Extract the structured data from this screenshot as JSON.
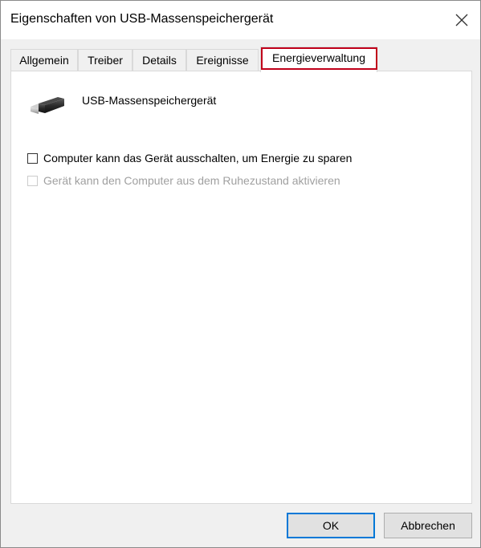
{
  "window": {
    "title": "Eigenschaften von USB-Massenspeichergerät"
  },
  "tabs": [
    {
      "label": "Allgemein",
      "active": false
    },
    {
      "label": "Treiber",
      "active": false
    },
    {
      "label": "Details",
      "active": false
    },
    {
      "label": "Ereignisse",
      "active": false
    },
    {
      "label": "Energieverwaltung",
      "active": true,
      "highlighted": true
    }
  ],
  "panel": {
    "device_name": "USB-Massenspeichergerät",
    "device_icon": "usb-plug-icon",
    "options": [
      {
        "label": "Computer kann das Gerät ausschalten, um Energie zu sparen",
        "checked": false,
        "enabled": true
      },
      {
        "label": "Gerät kann den Computer aus dem Ruhezustand aktivieren",
        "checked": false,
        "enabled": false
      }
    ]
  },
  "buttons": {
    "ok": "OK",
    "cancel": "Abbrechen"
  },
  "colors": {
    "highlight": "#c0001a",
    "default_button_border": "#0078d7"
  }
}
